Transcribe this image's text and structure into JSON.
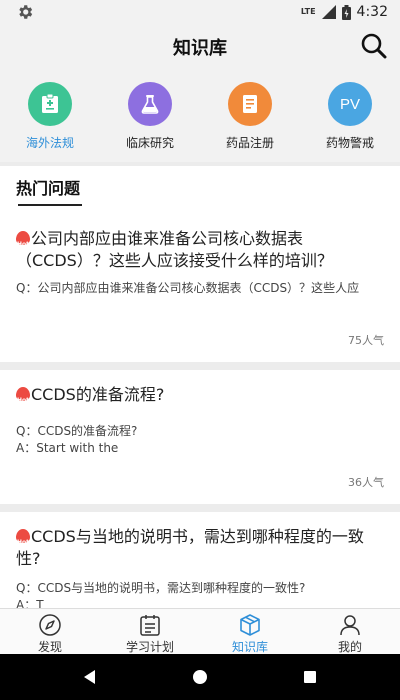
{
  "status_bar": {
    "time": "4:32",
    "network": "LTE"
  },
  "header": {
    "title": "知识库"
  },
  "categories": [
    {
      "label": "海外法规",
      "color": "#3dc494",
      "icon": "law-book-icon"
    },
    {
      "label": "临床研究",
      "color": "#8d6fe0",
      "icon": "flask-icon"
    },
    {
      "label": "药品注册",
      "color": "#f18a3a",
      "icon": "document-icon"
    },
    {
      "label": "药物警戒",
      "color": "#4aa6e2",
      "icon_text": "PV"
    }
  ],
  "section": {
    "title": "热门问题"
  },
  "badge_text": "Hot",
  "questions": [
    {
      "title": "公司内部应由谁来准备公司核心数据表（CCDS）？这些人应该接受什么样的培训？",
      "summary_line1": "Q：公司内部应由谁来准备公司核心数据表（CCDS）？这些人应",
      "summary_line2": "",
      "popularity": "75人气"
    },
    {
      "title": "CCDS的准备流程?",
      "summary_line1": "Q：CCDS的准备流程?",
      "summary_line2": "A：Start with the",
      "popularity": "36人气"
    },
    {
      "title": "CCDS与当地的说明书，需达到哪种程度的一致性?",
      "summary_line1": "Q：CCDS与当地的说明书，需达到哪种程度的一致性?",
      "summary_line2": "A：T"
    }
  ],
  "tabs": [
    {
      "label": "发现",
      "icon": "compass-icon"
    },
    {
      "label": "学习计划",
      "icon": "calendar-icon"
    },
    {
      "label": "知识库",
      "icon": "box-icon",
      "active": true
    },
    {
      "label": "我的",
      "icon": "person-icon"
    }
  ],
  "colors": {
    "accent": "#2f8fd8",
    "hot": "#ec4b42"
  }
}
